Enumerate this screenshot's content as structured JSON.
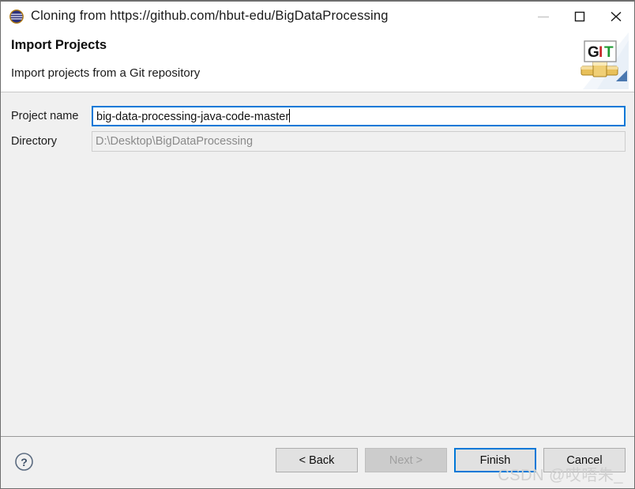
{
  "window": {
    "title": "Cloning from https://github.com/hbut-edu/BigDataProcessing",
    "icon": "eclipse-sphere-icon",
    "controls": {
      "minimize": "minimize-icon",
      "maximize": "maximize-icon",
      "close": "close-icon"
    }
  },
  "header": {
    "title": "Import Projects",
    "subtitle": "Import projects from a Git repository",
    "logo": {
      "name": "git-logo",
      "letters": [
        "G",
        "I",
        "T"
      ],
      "letter_colors": [
        "#1a1a1a",
        "#c7282a",
        "#1f9a34"
      ]
    }
  },
  "form": {
    "rows": [
      {
        "label": "Project name",
        "value": "big-data-processing-java-code-master",
        "state": "focused"
      },
      {
        "label": "Directory",
        "value": "D:\\Desktop\\BigDataProcessing",
        "state": "readonly"
      }
    ]
  },
  "footer": {
    "help": "help-icon",
    "buttons": [
      {
        "label": "< Back",
        "state": "enabled"
      },
      {
        "label": "Next >",
        "state": "disabled"
      },
      {
        "label": "Finish",
        "state": "default"
      },
      {
        "label": "Cancel",
        "state": "enabled"
      }
    ]
  },
  "watermark": "CSDN @哎唔朱_",
  "colors": {
    "accent": "#0078d7",
    "window_bg": "#f0f0f0",
    "header_bg": "#ffffff",
    "disabled_text": "#a0a0a0"
  }
}
